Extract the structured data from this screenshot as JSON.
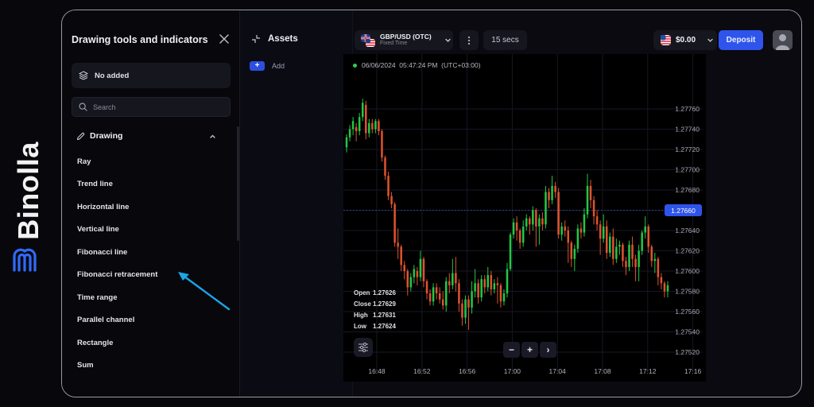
{
  "brand": {
    "name": "Binolla",
    "logo_icon": "binolla-m-logo",
    "accent": "#2f6bff"
  },
  "tools_panel": {
    "title": "Drawing tools and indicators",
    "close_icon": "close-icon",
    "added_label": "No added",
    "search_placeholder": "Search",
    "section": {
      "label": "Drawing",
      "expanded": true
    },
    "items": [
      {
        "label": "Ray"
      },
      {
        "label": "Trend line"
      },
      {
        "label": "Horizontal line"
      },
      {
        "label": "Vertical line"
      },
      {
        "label": "Fibonacci line"
      },
      {
        "label": "Fibonacci retracement"
      },
      {
        "label": "Time range"
      },
      {
        "label": "Parallel channel"
      },
      {
        "label": "Rectangle"
      },
      {
        "label": "Sum"
      }
    ],
    "annotation_arrow_color": "#19a6e8",
    "annotation_points_to": "Fibonacci retracement"
  },
  "assets_panel": {
    "title": "Assets",
    "add_label": "Add",
    "add_button": "+"
  },
  "topbar": {
    "pair": {
      "name": "GBP/USD (OTC)",
      "subtitle": "Fixed Time"
    },
    "timeframe": "15 secs",
    "balance": "$0.00",
    "deposit_label": "Deposit"
  },
  "chart": {
    "timestamp": "06/06/2024  05:47:24 PM  (UTC+03:00)",
    "current_price": "1.27660",
    "ohlc": [
      {
        "key": "Open",
        "value": "1.27626"
      },
      {
        "key": "Close",
        "value": "1.27629"
      },
      {
        "key": "High",
        "value": "1.27631"
      },
      {
        "key": "Low",
        "value": "1.27624"
      }
    ],
    "zoom_out": "−",
    "zoom_in": "+",
    "scroll_right": "›",
    "colors": {
      "up": "#22c845",
      "down": "#e0532e",
      "price_tag": "#2f54ec",
      "grid": "#171726"
    }
  },
  "chart_data": {
    "type": "candlestick",
    "title": "GBP/USD (OTC)",
    "xlabel": "",
    "ylabel": "",
    "y_ticks": [
      "1.27760",
      "1.27740",
      "1.27720",
      "1.27700",
      "1.27680",
      "1.27660",
      "1.27640",
      "1.27620",
      "1.27600",
      "1.27580",
      "1.27560",
      "1.27540",
      "1.27520"
    ],
    "x_ticks": [
      "16:48",
      "16:52",
      "16:56",
      "17:00",
      "17:04",
      "17:08",
      "17:12",
      "17:16"
    ],
    "ylim": [
      1.2751,
      1.27775
    ],
    "grid": true,
    "current_price": 1.2766,
    "candles": [
      [
        1.27722,
        1.27732,
        1.27717,
        1.27735
      ],
      [
        1.27732,
        1.2774,
        1.27728,
        1.27744
      ],
      [
        1.2774,
        1.27748,
        1.27734,
        1.27752
      ],
      [
        1.27742,
        1.27738,
        1.27728,
        1.27746
      ],
      [
        1.27738,
        1.27752,
        1.27734,
        1.27756
      ],
      [
        1.27752,
        1.27766,
        1.27748,
        1.2777
      ],
      [
        1.27764,
        1.27736,
        1.2773,
        1.27768
      ],
      [
        1.27736,
        1.27746,
        1.27732,
        1.2775
      ],
      [
        1.27746,
        1.2774,
        1.27736,
        1.2775
      ],
      [
        1.2774,
        1.27748,
        1.27736,
        1.2775
      ],
      [
        1.27748,
        1.27738,
        1.27734,
        1.2775
      ],
      [
        1.27738,
        1.27712,
        1.27708,
        1.2774
      ],
      [
        1.27712,
        1.27694,
        1.2769,
        1.27714
      ],
      [
        1.27694,
        1.27674,
        1.2767,
        1.27698
      ],
      [
        1.27674,
        1.27666,
        1.27662,
        1.27678
      ],
      [
        1.27666,
        1.27628,
        1.27624,
        1.27668
      ],
      [
        1.27628,
        1.27624,
        1.27612,
        1.27642
      ],
      [
        1.27624,
        1.27606,
        1.276,
        1.27626
      ],
      [
        1.27606,
        1.276,
        1.27592,
        1.2761
      ],
      [
        1.276,
        1.27584,
        1.27576,
        1.27602
      ],
      [
        1.27584,
        1.27594,
        1.2758,
        1.27598
      ],
      [
        1.27594,
        1.27602,
        1.27588,
        1.27606
      ],
      [
        1.276,
        1.27594,
        1.27586,
        1.27604
      ],
      [
        1.27594,
        1.27612,
        1.2759,
        1.2762
      ],
      [
        1.27612,
        1.2759,
        1.27584,
        1.27614
      ],
      [
        1.2759,
        1.27578,
        1.27572,
        1.27592
      ],
      [
        1.27578,
        1.2757,
        1.27566,
        1.27582
      ],
      [
        1.2757,
        1.27584,
        1.27566,
        1.27588
      ],
      [
        1.27584,
        1.27578,
        1.27572,
        1.27588
      ],
      [
        1.27578,
        1.27572,
        1.27568,
        1.27584
      ],
      [
        1.27572,
        1.27566,
        1.27562,
        1.2758
      ],
      [
        1.27566,
        1.2759,
        1.2756,
        1.27594
      ],
      [
        1.2759,
        1.27586,
        1.27578,
        1.27598
      ],
      [
        1.27586,
        1.27598,
        1.27582,
        1.27612
      ],
      [
        1.27598,
        1.27588,
        1.2758,
        1.27614
      ],
      [
        1.27588,
        1.27568,
        1.2756,
        1.27592
      ],
      [
        1.27568,
        1.27554,
        1.27546,
        1.27572
      ],
      [
        1.27554,
        1.27572,
        1.27548,
        1.27576
      ],
      [
        1.27572,
        1.27564,
        1.27542,
        1.27576
      ],
      [
        1.27564,
        1.2758,
        1.27558,
        1.2759
      ],
      [
        1.2758,
        1.27588,
        1.27574,
        1.27602
      ],
      [
        1.27588,
        1.27574,
        1.27568,
        1.27592
      ],
      [
        1.27574,
        1.27592,
        1.2757,
        1.27596
      ],
      [
        1.27592,
        1.27584,
        1.27578,
        1.27596
      ],
      [
        1.27584,
        1.27596,
        1.2758,
        1.27604
      ],
      [
        1.27596,
        1.27582,
        1.27576,
        1.276
      ],
      [
        1.27582,
        1.27588,
        1.27578,
        1.27592
      ],
      [
        1.27588,
        1.27586,
        1.27568,
        1.27594
      ],
      [
        1.27586,
        1.2757,
        1.27564,
        1.27588
      ],
      [
        1.2757,
        1.27578,
        1.27566,
        1.27582
      ],
      [
        1.27578,
        1.27602,
        1.27574,
        1.27608
      ],
      [
        1.27602,
        1.27636,
        1.276,
        1.27638
      ],
      [
        1.27636,
        1.27648,
        1.27632,
        1.27652
      ],
      [
        1.27648,
        1.2764,
        1.2763,
        1.27654
      ],
      [
        1.2764,
        1.27628,
        1.27622,
        1.27642
      ],
      [
        1.27628,
        1.27644,
        1.27624,
        1.2765
      ],
      [
        1.27644,
        1.27652,
        1.2764,
        1.27656
      ],
      [
        1.27652,
        1.27646,
        1.27636,
        1.27654
      ],
      [
        1.27646,
        1.2766,
        1.2764,
        1.27664
      ],
      [
        1.2766,
        1.27644,
        1.27624,
        1.27662
      ],
      [
        1.27644,
        1.27652,
        1.27626,
        1.27656
      ],
      [
        1.27652,
        1.27646,
        1.2764,
        1.27658
      ],
      [
        1.27646,
        1.27678,
        1.27642,
        1.27684
      ],
      [
        1.27678,
        1.2767,
        1.27662,
        1.27682
      ],
      [
        1.2767,
        1.27684,
        1.27666,
        1.27694
      ],
      [
        1.27684,
        1.27678,
        1.27672,
        1.27688
      ],
      [
        1.27678,
        1.27636,
        1.27632,
        1.27682
      ],
      [
        1.27636,
        1.27644,
        1.2763,
        1.27648
      ],
      [
        1.27644,
        1.2764,
        1.27634,
        1.2765
      ],
      [
        1.2764,
        1.27628,
        1.27608,
        1.27644
      ],
      [
        1.27628,
        1.27612,
        1.27604,
        1.2763
      ],
      [
        1.27612,
        1.27622,
        1.276,
        1.27626
      ],
      [
        1.27622,
        1.27642,
        1.27618,
        1.27646
      ],
      [
        1.27642,
        1.27638,
        1.27632,
        1.27648
      ],
      [
        1.27638,
        1.27656,
        1.27634,
        1.27662
      ],
      [
        1.27656,
        1.27684,
        1.27652,
        1.27696
      ],
      [
        1.27684,
        1.2767,
        1.27662,
        1.2769
      ],
      [
        1.2767,
        1.27654,
        1.27646,
        1.27674
      ],
      [
        1.27654,
        1.27646,
        1.2764,
        1.2766
      ],
      [
        1.27646,
        1.27632,
        1.27616,
        1.2765
      ],
      [
        1.27632,
        1.27644,
        1.27628,
        1.27656
      ],
      [
        1.27644,
        1.27618,
        1.27612,
        1.2765
      ],
      [
        1.27618,
        1.27634,
        1.27614,
        1.27638
      ],
      [
        1.27634,
        1.27612,
        1.27606,
        1.27642
      ],
      [
        1.27612,
        1.27624,
        1.27608,
        1.27632
      ],
      [
        1.27624,
        1.27626,
        1.27616,
        1.2763
      ],
      [
        1.27626,
        1.2761,
        1.27604,
        1.27628
      ],
      [
        1.2761,
        1.27604,
        1.27596,
        1.27614
      ],
      [
        1.27604,
        1.27626,
        1.276,
        1.2763
      ],
      [
        1.27626,
        1.27612,
        1.27604,
        1.27634
      ],
      [
        1.27612,
        1.27604,
        1.2759,
        1.27616
      ],
      [
        1.27604,
        1.2762,
        1.2759,
        1.27626
      ],
      [
        1.2762,
        1.27638,
        1.27616,
        1.2764
      ],
      [
        1.27638,
        1.27644,
        1.27632,
        1.27654
      ],
      [
        1.27644,
        1.27624,
        1.27618,
        1.27646
      ],
      [
        1.27624,
        1.2761,
        1.27604,
        1.27626
      ],
      [
        1.2761,
        1.27612,
        1.27598,
        1.27618
      ],
      [
        1.27612,
        1.27594,
        1.27586,
        1.27614
      ],
      [
        1.27594,
        1.27588,
        1.27582,
        1.27598
      ],
      [
        1.27588,
        1.2758,
        1.27574,
        1.2759
      ],
      [
        1.2758,
        1.27586,
        1.27574,
        1.2759
      ]
    ]
  }
}
